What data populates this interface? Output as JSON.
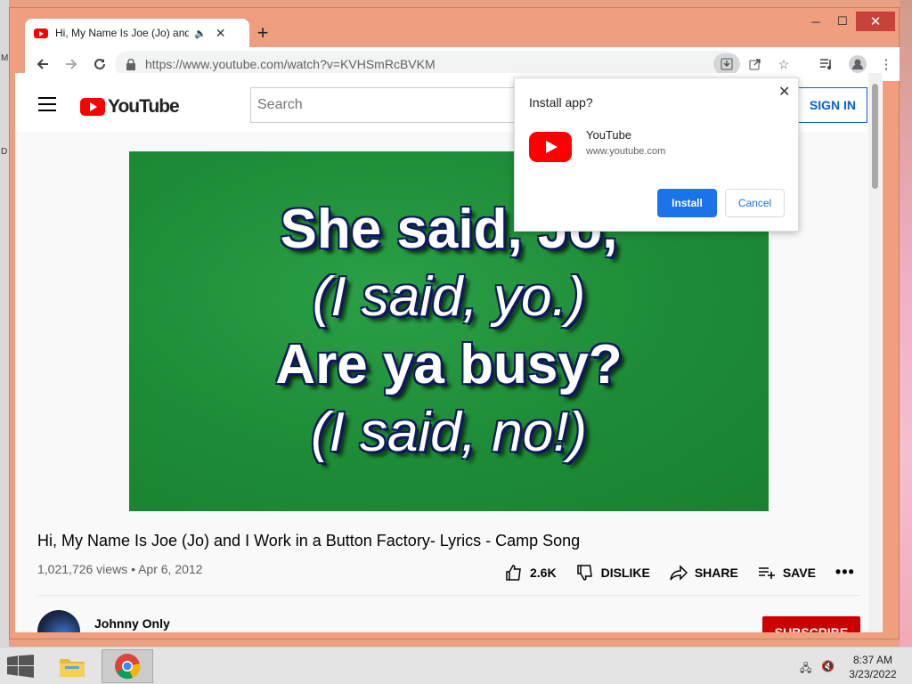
{
  "desktop": {
    "left_glyphs": [
      "M",
      "D"
    ]
  },
  "window": {
    "minimize": "─",
    "maximize": "☐",
    "close": "✕"
  },
  "tab": {
    "title": "Hi, My Name Is Joe (Jo) and I Work in a Button Factory- Lyrics - Camp Song",
    "audio_icon": "speaker-icon",
    "close": "✕"
  },
  "toolbar": {
    "url": "https://www.youtube.com/watch?v=KVHSmRcBVKM"
  },
  "youtube": {
    "logo_text": "YouTube",
    "search_placeholder": "Search",
    "sign_in": "SIGN IN"
  },
  "video": {
    "lyrics": [
      "She said, Jo,",
      "(I said, yo.)",
      "Are ya busy?",
      "(I said, no!)"
    ],
    "title": "Hi, My Name Is Joe (Jo) and I Work in a Button Factory- Lyrics - Camp Song",
    "views": "1,021,726 views • Apr 6, 2012",
    "likes": "2.6K",
    "dislike": "DISLIKE",
    "share": "SHARE",
    "save": "SAVE",
    "more": "•••",
    "channel": "Johnny Only",
    "subscribe": "SUBSCRIBE"
  },
  "install_popup": {
    "title": "Install app?",
    "app_name": "YouTube",
    "app_url": "www.youtube.com",
    "install": "Install",
    "cancel": "Cancel",
    "close": "✕"
  },
  "taskbar": {
    "time": "8:37 AM",
    "date": "3/23/2022"
  }
}
